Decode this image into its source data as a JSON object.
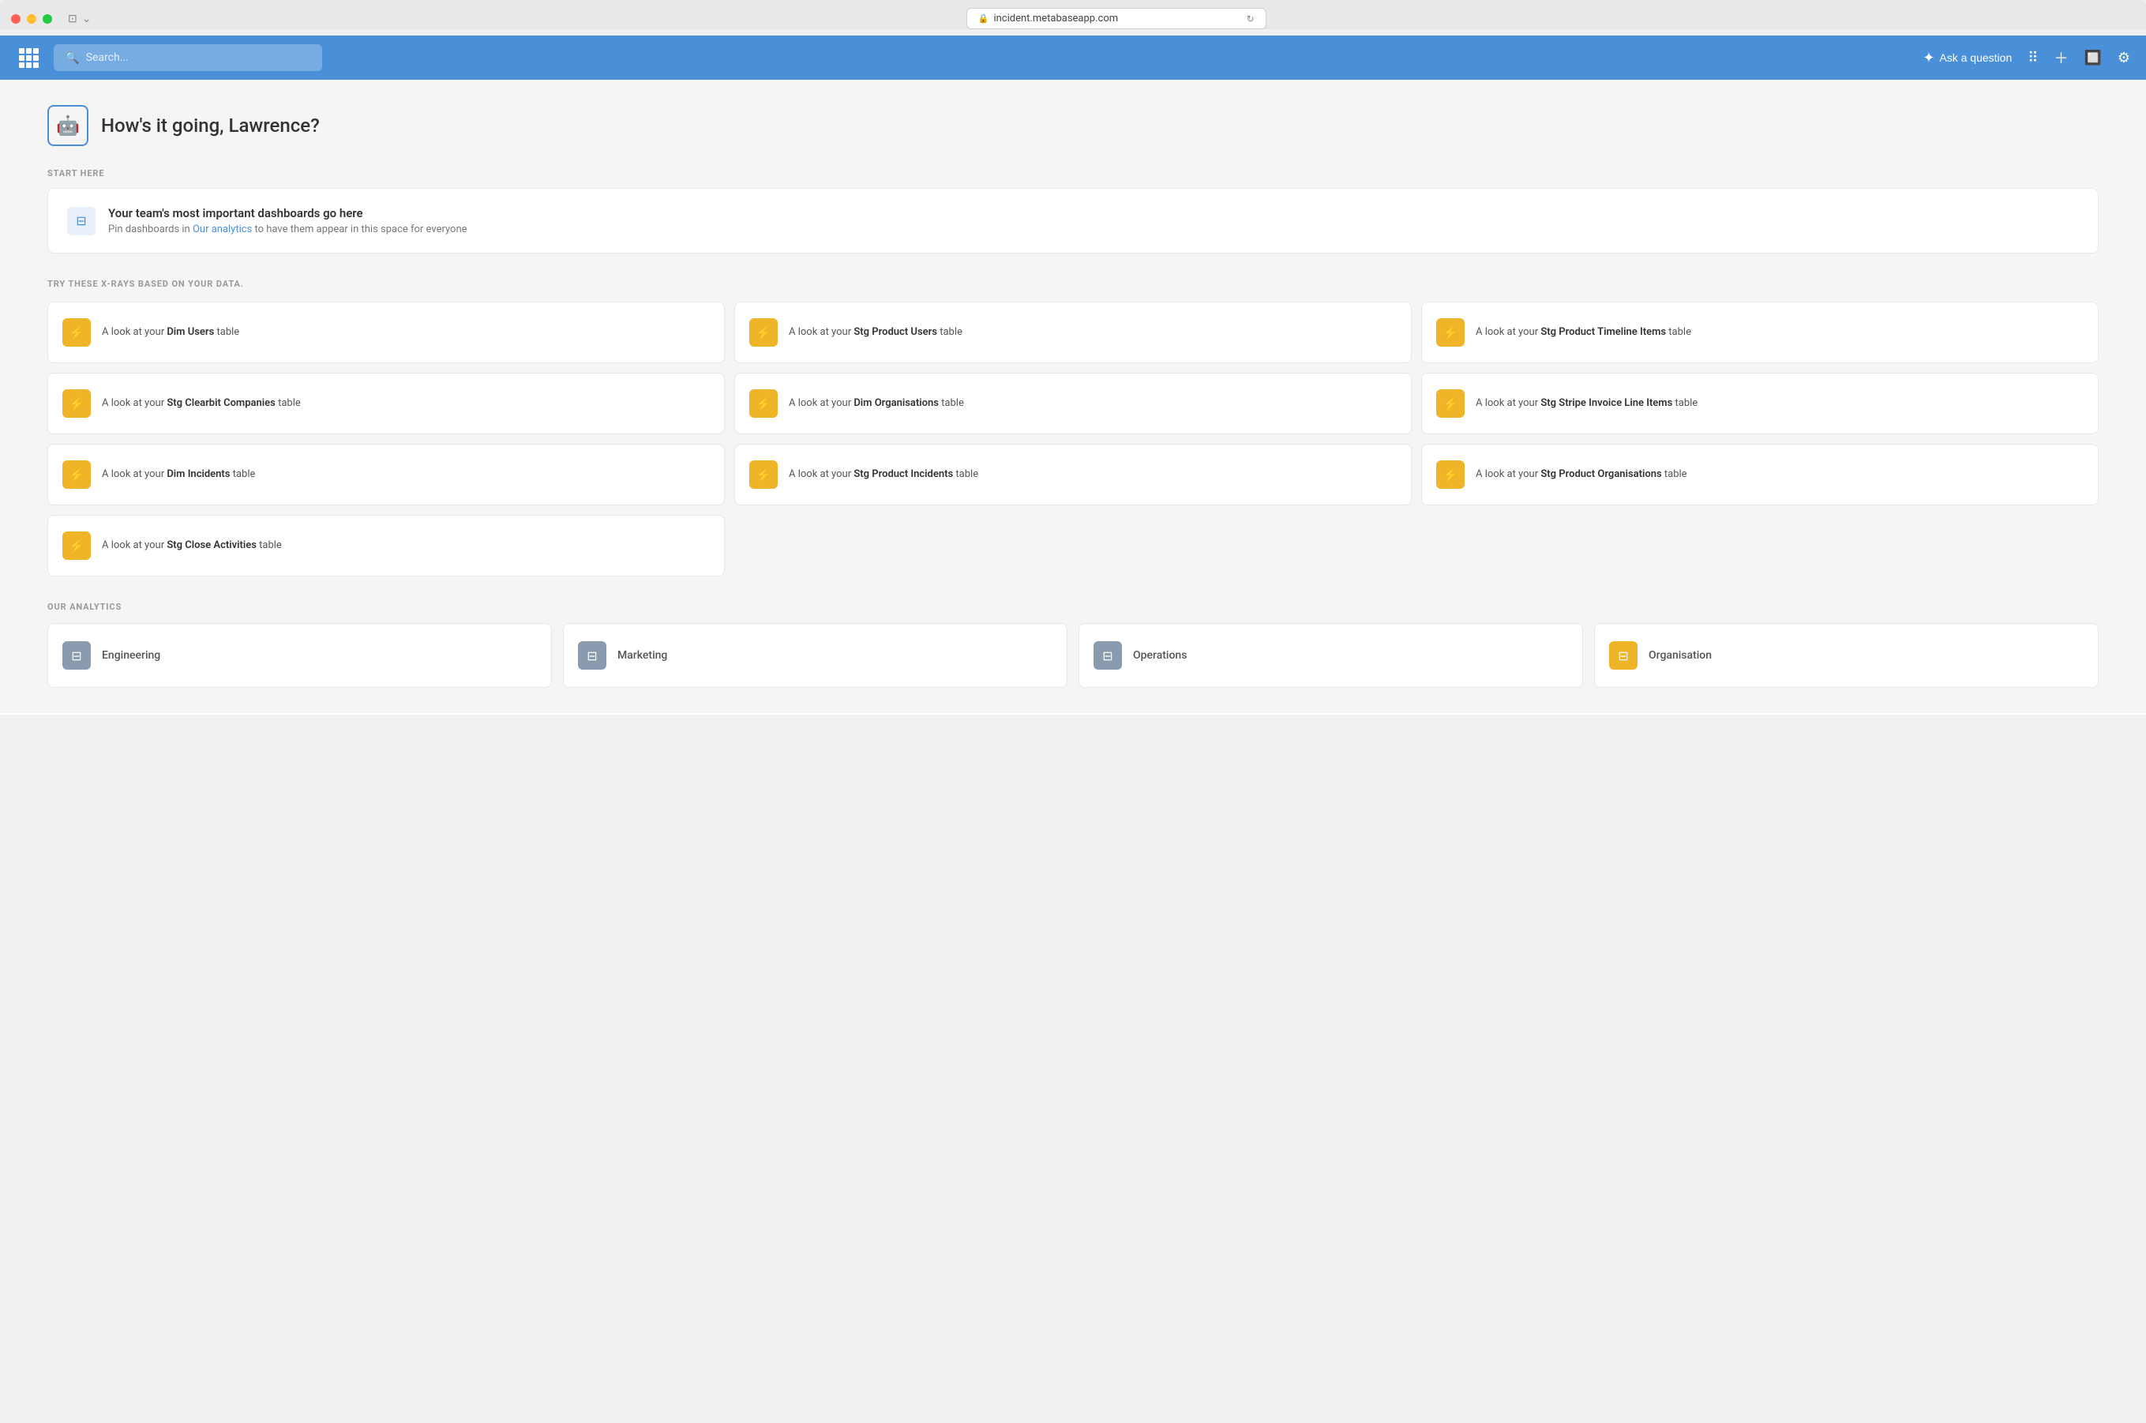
{
  "browser": {
    "url": "incident.metabaseapp.com"
  },
  "header": {
    "search_placeholder": "Search...",
    "ask_question_label": "Ask a question"
  },
  "greeting": {
    "title": "How's it going, Lawrence?"
  },
  "start_here": {
    "label": "START HERE",
    "banner": {
      "title": "Your team's most important dashboards go here",
      "subtitle_prefix": "Pin dashboards in ",
      "subtitle_link": "Our analytics",
      "subtitle_suffix": " to have them appear in this space for everyone"
    }
  },
  "xrays": {
    "label": "TRY THESE X-RAYS BASED ON YOUR DATA.",
    "items": [
      {
        "prefix": "A look at your ",
        "bold": "Dim Users",
        "suffix": " table"
      },
      {
        "prefix": "A look at your ",
        "bold": "Stg Product Users",
        "suffix": " table"
      },
      {
        "prefix": "A look at your ",
        "bold": "Stg Product Timeline Items",
        "suffix": " table"
      },
      {
        "prefix": "A look at your ",
        "bold": "Stg Clearbit Companies",
        "suffix": " table"
      },
      {
        "prefix": "A look at your ",
        "bold": "Dim Organisations",
        "suffix": " table"
      },
      {
        "prefix": "A look at your ",
        "bold": "Stg Stripe Invoice Line Items",
        "suffix": " table"
      },
      {
        "prefix": "A look at your ",
        "bold": "Dim Incidents",
        "suffix": " table"
      },
      {
        "prefix": "A look at your ",
        "bold": "Stg Product Incidents",
        "suffix": " table"
      },
      {
        "prefix": "A look at your ",
        "bold": "Stg Product Organisations",
        "suffix": " table"
      },
      {
        "prefix": "A look at your ",
        "bold": "Stg Close Activities",
        "suffix": " table"
      }
    ]
  },
  "our_analytics": {
    "label": "OUR ANALYTICS",
    "items": [
      {
        "label": "Engineering",
        "icon_type": "gray"
      },
      {
        "label": "Marketing",
        "icon_type": "gray"
      },
      {
        "label": "Operations",
        "icon_type": "gray"
      },
      {
        "label": "Organisation",
        "icon_type": "yellow"
      }
    ]
  }
}
